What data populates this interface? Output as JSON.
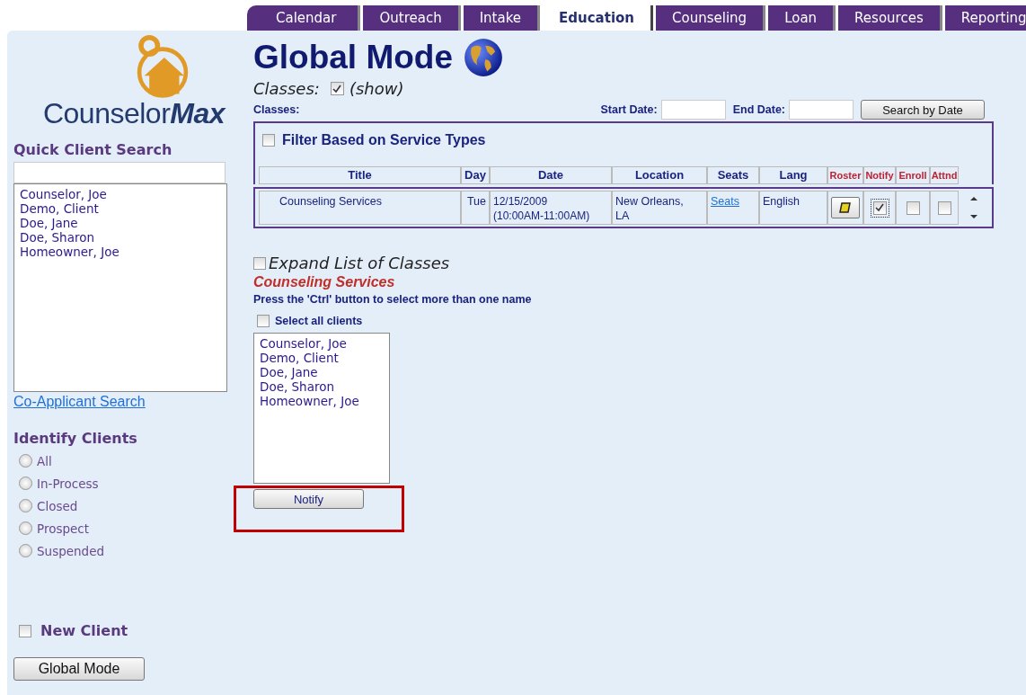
{
  "tabs": [
    {
      "label": "Calendar",
      "selected": false
    },
    {
      "label": "Outreach",
      "selected": false
    },
    {
      "label": "Intake",
      "selected": false
    },
    {
      "label": "Education",
      "selected": true
    },
    {
      "label": "Counseling",
      "selected": false
    },
    {
      "label": "Loan",
      "selected": false
    },
    {
      "label": "Resources",
      "selected": false
    },
    {
      "label": "Reporting",
      "selected": false
    }
  ],
  "sidebar": {
    "logo": {
      "light": "Counselor",
      "bold": "Max"
    },
    "quick_search": {
      "title": "Quick Client Search"
    },
    "clients": [
      "Counselor, Joe",
      "Demo, Client",
      "Doe, Jane",
      "Doe, Sharon",
      "Homeowner, Joe"
    ],
    "co_applicant_link": "Co-Applicant Search",
    "identify": {
      "title": "Identify Clients",
      "options": [
        {
          "label": "All",
          "selected": false
        },
        {
          "label": "In-Process",
          "selected": false
        },
        {
          "label": "Closed",
          "selected": false
        },
        {
          "label": "Prospect",
          "selected": false
        },
        {
          "label": "Suspended",
          "selected": false
        }
      ]
    },
    "new_client": {
      "label": "New Client",
      "checked": false
    },
    "global_mode_button": "Global Mode"
  },
  "main": {
    "title": "Global Mode",
    "classes_toggle": {
      "label": "Classes:",
      "checked": true,
      "note": "(show)"
    },
    "classes_label": "Classes:",
    "start_date": {
      "label": "Start Date:"
    },
    "end_date": {
      "label": "End Date:"
    },
    "search_button": "Search by Date",
    "filter": {
      "label": "Filter Based on Service Types",
      "checked": false
    },
    "table": {
      "columns": [
        {
          "label": "Title",
          "kind": "plain"
        },
        {
          "label": "Day",
          "kind": "plain"
        },
        {
          "label": "Date",
          "kind": "plain"
        },
        {
          "label": "Location",
          "kind": "plain"
        },
        {
          "label": "Seats",
          "kind": "plain"
        },
        {
          "label": "Lang",
          "kind": "plain"
        },
        {
          "label": "Roster",
          "kind": "action"
        },
        {
          "label": "Notify",
          "kind": "action"
        },
        {
          "label": "Enroll",
          "kind": "action"
        },
        {
          "label": "Attnd",
          "kind": "action"
        }
      ],
      "rows": [
        {
          "title": "Counseling Services",
          "day": "Tue",
          "date": "12/15/2009 (10:00AM-11:00AM)",
          "location": "New Orleans, LA",
          "seats": "Seats",
          "lang": "English",
          "notify": true,
          "enroll": false,
          "attnd": false
        }
      ]
    },
    "expand": {
      "label": "Expand List of Classes",
      "checked": false
    },
    "selected_class": "Counseling Services",
    "hint": "Press the 'Ctrl' button to select more than one name",
    "select_all": {
      "label": "Select all clients",
      "checked": false
    },
    "clients": [
      "Counselor, Joe",
      "Demo, Client",
      "Doe, Jane",
      "Doe, Sharon",
      "Homeowner, Joe"
    ],
    "notify_button": "Notify",
    "highlight": true
  }
}
